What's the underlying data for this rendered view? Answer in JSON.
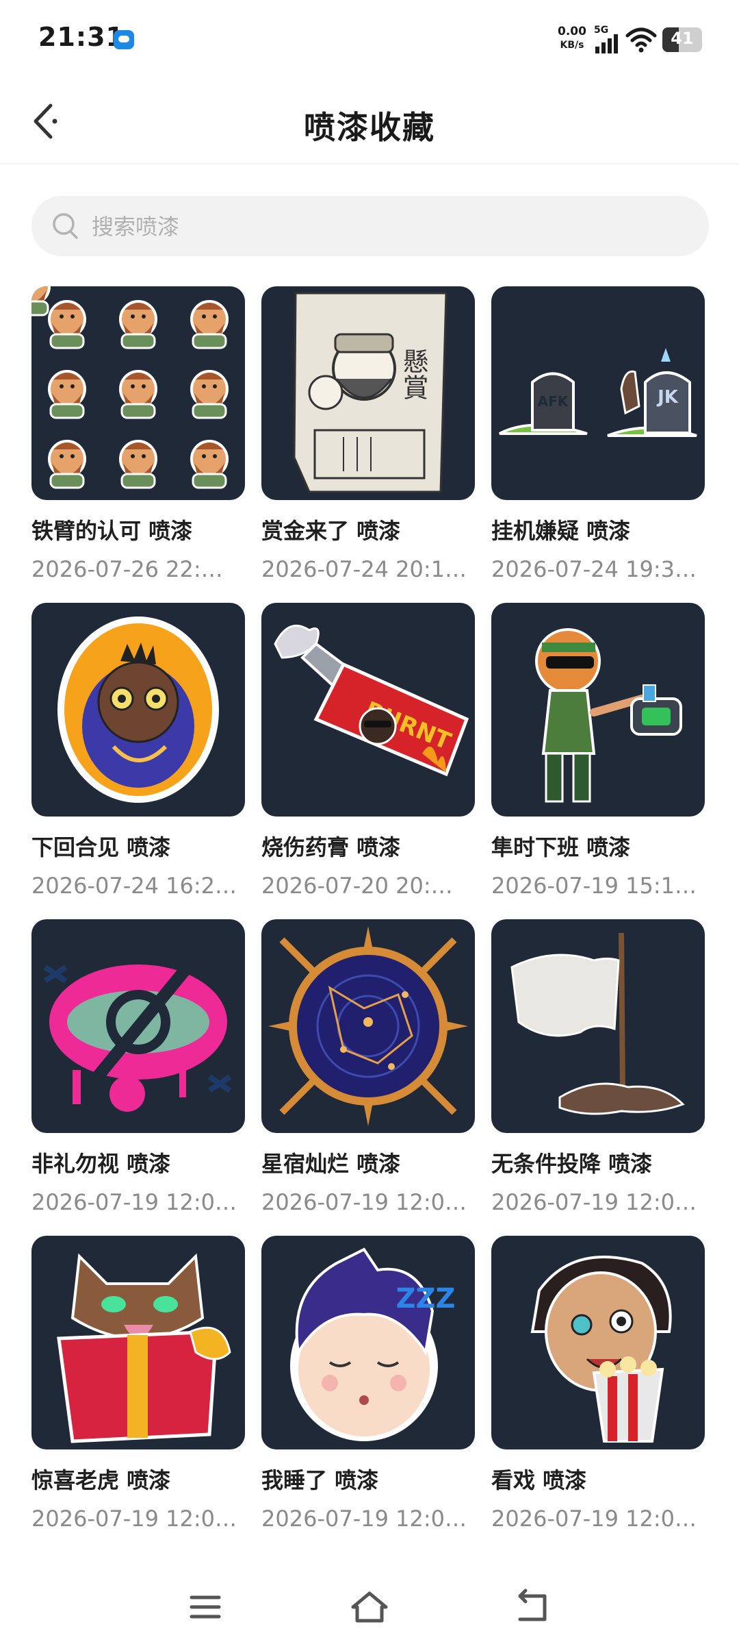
{
  "status_bar": {
    "time": "21:31",
    "speed_value": "0.00",
    "speed_unit": "KB/s",
    "network": "5G",
    "battery": "41"
  },
  "header": {
    "title": "喷漆收藏",
    "back_icon": "chevron-left-icon"
  },
  "search": {
    "placeholder": "搜索喷漆",
    "icon": "search-icon"
  },
  "colors": {
    "thumb_background": "#1f2937",
    "date_text": "#8a8a8a"
  },
  "sprays": [
    {
      "name": "铁臂的认可 喷漆",
      "date": "2026-07-26 22:…"
    },
    {
      "name": "赏金来了 喷漆",
      "date": "2026-07-24 20:1…"
    },
    {
      "name": "挂机嫌疑 喷漆",
      "date": "2026-07-24 19:3…"
    },
    {
      "name": "下回合见 喷漆",
      "date": "2026-07-24 16:2…"
    },
    {
      "name": "烧伤药膏 喷漆",
      "date": "2026-07-20 20:…"
    },
    {
      "name": "隼时下班 喷漆",
      "date": "2026-07-19 15:1…"
    },
    {
      "name": "非礼勿视 喷漆",
      "date": "2026-07-19 12:0…"
    },
    {
      "name": "星宿灿烂 喷漆",
      "date": "2026-07-19 12:0…"
    },
    {
      "name": "无条件投降 喷漆",
      "date": "2026-07-19 12:0…"
    },
    {
      "name": "惊喜老虎 喷漆",
      "date": "2026-07-19 12:0…"
    },
    {
      "name": "我睡了 喷漆",
      "date": "2026-07-19 12:0…"
    },
    {
      "name": "看戏 喷漆",
      "date": "2026-07-19 12:0…"
    }
  ],
  "spray_art": {
    "tomb_left": "AFK",
    "tomb_right": "JK",
    "banner": "BURNT",
    "wanted_chars": "懸賞",
    "sleep_chars": "ZZZ"
  },
  "navbar": {
    "menu_icon": "menu-icon",
    "home_icon": "home-icon",
    "back_icon": "back-arrow-icon"
  }
}
